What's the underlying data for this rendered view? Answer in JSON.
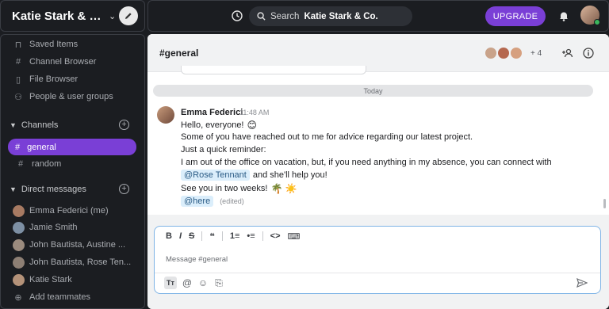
{
  "workspace": {
    "name": "Katie Stark & C...",
    "caret": "⌄"
  },
  "topbar": {
    "search_placeholder": "Search",
    "search_workspace": "Katie Stark & Co.",
    "upgrade_label": "UPGRADE"
  },
  "sidebar": {
    "nav": [
      {
        "icon": "bookmark-icon",
        "glyph": "⊓",
        "label": "Saved Items"
      },
      {
        "icon": "channel-browser-icon",
        "glyph": "#",
        "label": "Channel Browser"
      },
      {
        "icon": "file-browser-icon",
        "glyph": "▯",
        "label": "File Browser"
      },
      {
        "icon": "people-icon",
        "glyph": "⚇",
        "label": "People & user groups"
      }
    ],
    "channels_header": "Channels",
    "channels": [
      {
        "label": "general",
        "active": true
      },
      {
        "label": "random",
        "active": false
      }
    ],
    "dm_header": "Direct messages",
    "dms": [
      {
        "label": "Emma Federici (me)",
        "avatar_color": "#a77a62"
      },
      {
        "label": "Jamie Smith",
        "avatar_color": "#7d8fa3"
      },
      {
        "label": "John Bautista, Austine ...",
        "avatar_color": "#9b8b7e"
      },
      {
        "label": "John Bautista, Rose Ten...",
        "avatar_color": "#8d7f74"
      },
      {
        "label": "Katie Stark",
        "avatar_color": "#b49279"
      }
    ],
    "add_teammates": "Add teammates"
  },
  "channel": {
    "title": "#general",
    "member_count": "+ 4",
    "member_colors": [
      "#c9a38a",
      "#b5684f",
      "#d6a07f"
    ]
  },
  "messages": {
    "divider": "Today",
    "author": "Emma Federici",
    "time": "11:48 AM",
    "line1": "Hello, everyone!",
    "line1_emoji": "😊",
    "line2": "Some of you have reached out to me for advice regarding our latest project.",
    "line3": "Just a quick reminder:",
    "line4": "I am out of the office on vacation, but, if you need anything in my absence, you can connect with",
    "mention_rose": "@Rose Tennant",
    "line5_after": "and she'll help you!",
    "line6": "See you in two weeks!",
    "line6_emoji": "🌴 ☀️",
    "mention_here": "@here",
    "edited": "(edited)"
  },
  "composer": {
    "placeholder": "Message #general",
    "tools": [
      "B",
      "I",
      "S",
      "❝",
      "1≡",
      "•≡",
      "<>",
      "⌨"
    ],
    "tt_label": "Tт"
  },
  "colors": {
    "accent": "#7a3fd6",
    "sidebar_bg": "#1b1d21",
    "mention_bg": "#dbeefb"
  }
}
